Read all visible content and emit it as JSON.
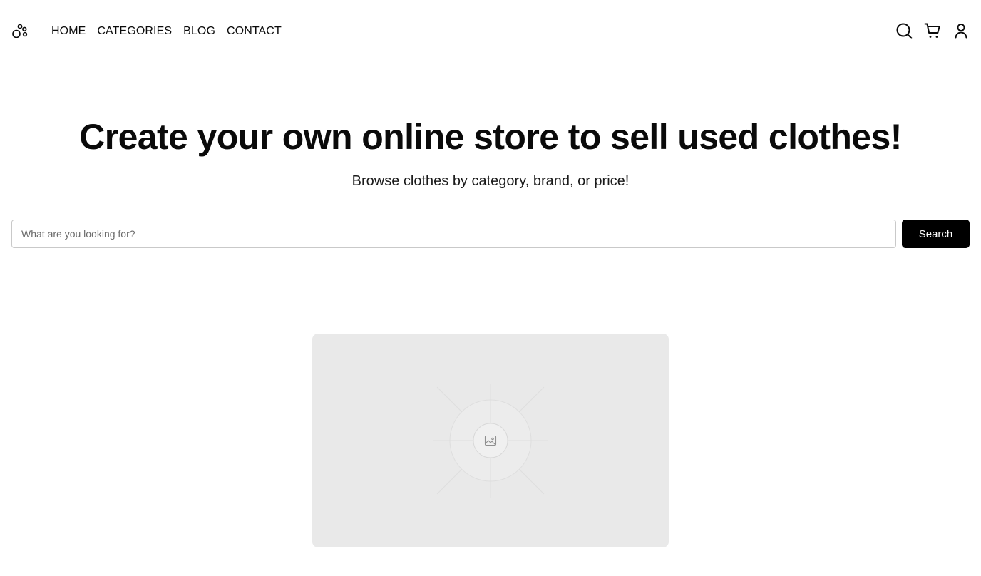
{
  "header": {
    "nav": [
      {
        "label": "HOME"
      },
      {
        "label": "CATEGORIES"
      },
      {
        "label": "BLOG"
      },
      {
        "label": "CONTACT"
      }
    ],
    "icons": {
      "logo": "paw-logo-icon",
      "search": "search-icon",
      "cart": "cart-icon",
      "account": "user-icon"
    }
  },
  "hero": {
    "title": "Create your own online store to sell used clothes!",
    "subtitle": "Browse clothes by category, brand, or price!"
  },
  "search": {
    "placeholder": "What are you looking for?",
    "value": "",
    "button_label": "Search"
  },
  "featured_image": {
    "icon": "image-placeholder-icon"
  },
  "colors": {
    "text": "#0a0a0a",
    "button_bg": "#000000",
    "placeholder_bg": "#e9e9e9"
  }
}
